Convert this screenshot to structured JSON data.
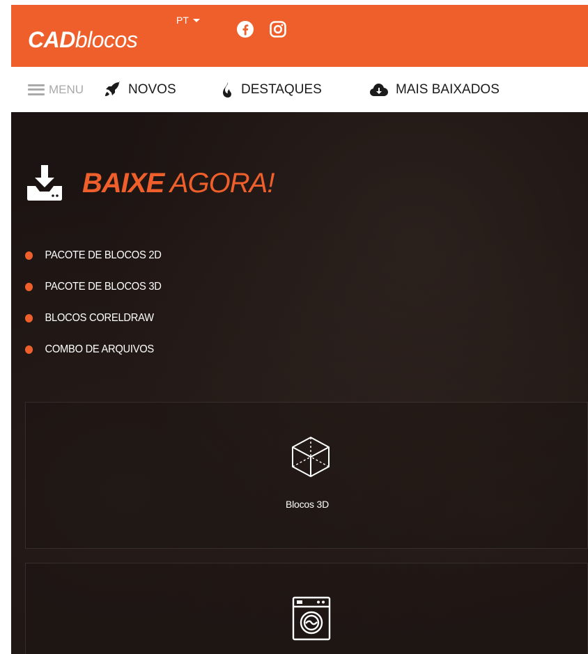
{
  "header": {
    "logo_strong": "CAD",
    "logo_light": "blocos",
    "language": "PT",
    "social": [
      "facebook-icon",
      "instagram-icon"
    ]
  },
  "nav": {
    "menu_label": "MENU",
    "items": [
      {
        "label": "NOVOS",
        "icon": "rocket-icon"
      },
      {
        "label": "DESTAQUES",
        "icon": "flame-icon"
      },
      {
        "label": "MAIS BAIXADOS",
        "icon": "cloud-download-icon"
      }
    ]
  },
  "hero": {
    "title_strong": "BAIXE",
    "title_light": " AGORA!",
    "list": [
      "PACOTE DE BLOCOS 2D",
      "PACOTE DE BLOCOS 3D",
      "BLOCOS CORELDRAW",
      "COMBO DE ARQUIVOS"
    ]
  },
  "cards": [
    {
      "label": "Blocos 3D",
      "icon": "cube-3d-icon"
    },
    {
      "label": "",
      "icon": "washing-machine-icon"
    }
  ],
  "colors": {
    "accent": "#ee5f2b",
    "nav_text": "#1b1b1b",
    "menu_gray": "#a9a9a9",
    "hero_bg": "#1c1412"
  }
}
